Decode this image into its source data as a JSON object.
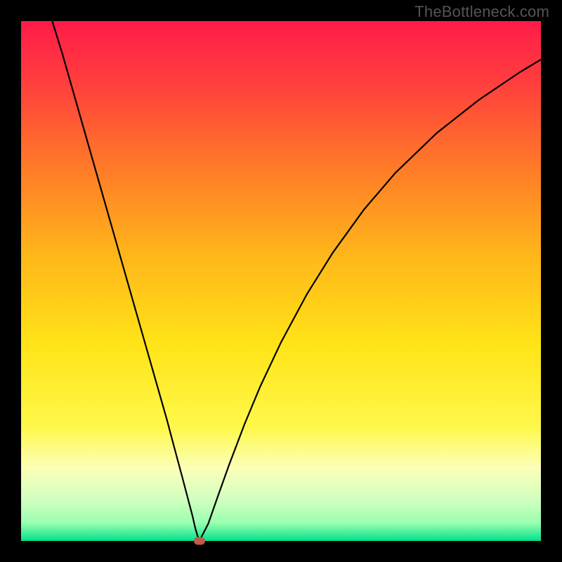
{
  "watermark": "TheBottleneck.com",
  "chart_data": {
    "type": "line",
    "title": "",
    "xlabel": "",
    "ylabel": "",
    "xlim": [
      0,
      100
    ],
    "ylim": [
      0,
      100
    ],
    "grid": false,
    "legend": false,
    "background_gradient": {
      "stops": [
        {
          "offset": 0.0,
          "color": "#ff1b49"
        },
        {
          "offset": 0.12,
          "color": "#ff3f3d"
        },
        {
          "offset": 0.28,
          "color": "#ff7a28"
        },
        {
          "offset": 0.45,
          "color": "#ffb61a"
        },
        {
          "offset": 0.62,
          "color": "#ffe317"
        },
        {
          "offset": 0.78,
          "color": "#fff84a"
        },
        {
          "offset": 0.86,
          "color": "#fbffb8"
        },
        {
          "offset": 0.92,
          "color": "#d1ffc0"
        },
        {
          "offset": 0.965,
          "color": "#9bffb0"
        },
        {
          "offset": 1.0,
          "color": "#00e28a"
        }
      ]
    },
    "series": [
      {
        "name": "curve",
        "stroke": "#000000",
        "stroke_width": 2.2,
        "x": [
          6,
          8,
          10,
          12,
          14,
          16,
          18,
          20,
          22,
          24,
          26,
          28,
          30,
          31,
          32,
          33,
          33.5,
          34,
          34.3,
          36,
          38,
          40,
          43,
          46,
          50,
          55,
          60,
          66,
          72,
          80,
          88,
          96,
          100
        ],
        "y": [
          100,
          93.5,
          86.5,
          79.5,
          72.5,
          65.5,
          58.5,
          51.5,
          44.5,
          37.5,
          30.5,
          23.5,
          16.0,
          12.3,
          8.5,
          4.7,
          2.5,
          0.8,
          0.0,
          3.3,
          9.0,
          14.6,
          22.5,
          29.7,
          38.2,
          47.5,
          55.5,
          63.8,
          70.8,
          78.5,
          84.8,
          90.2,
          92.6
        ]
      }
    ],
    "marker": {
      "x": 34.3,
      "y": 0.0,
      "color": "#c15a4a"
    }
  }
}
